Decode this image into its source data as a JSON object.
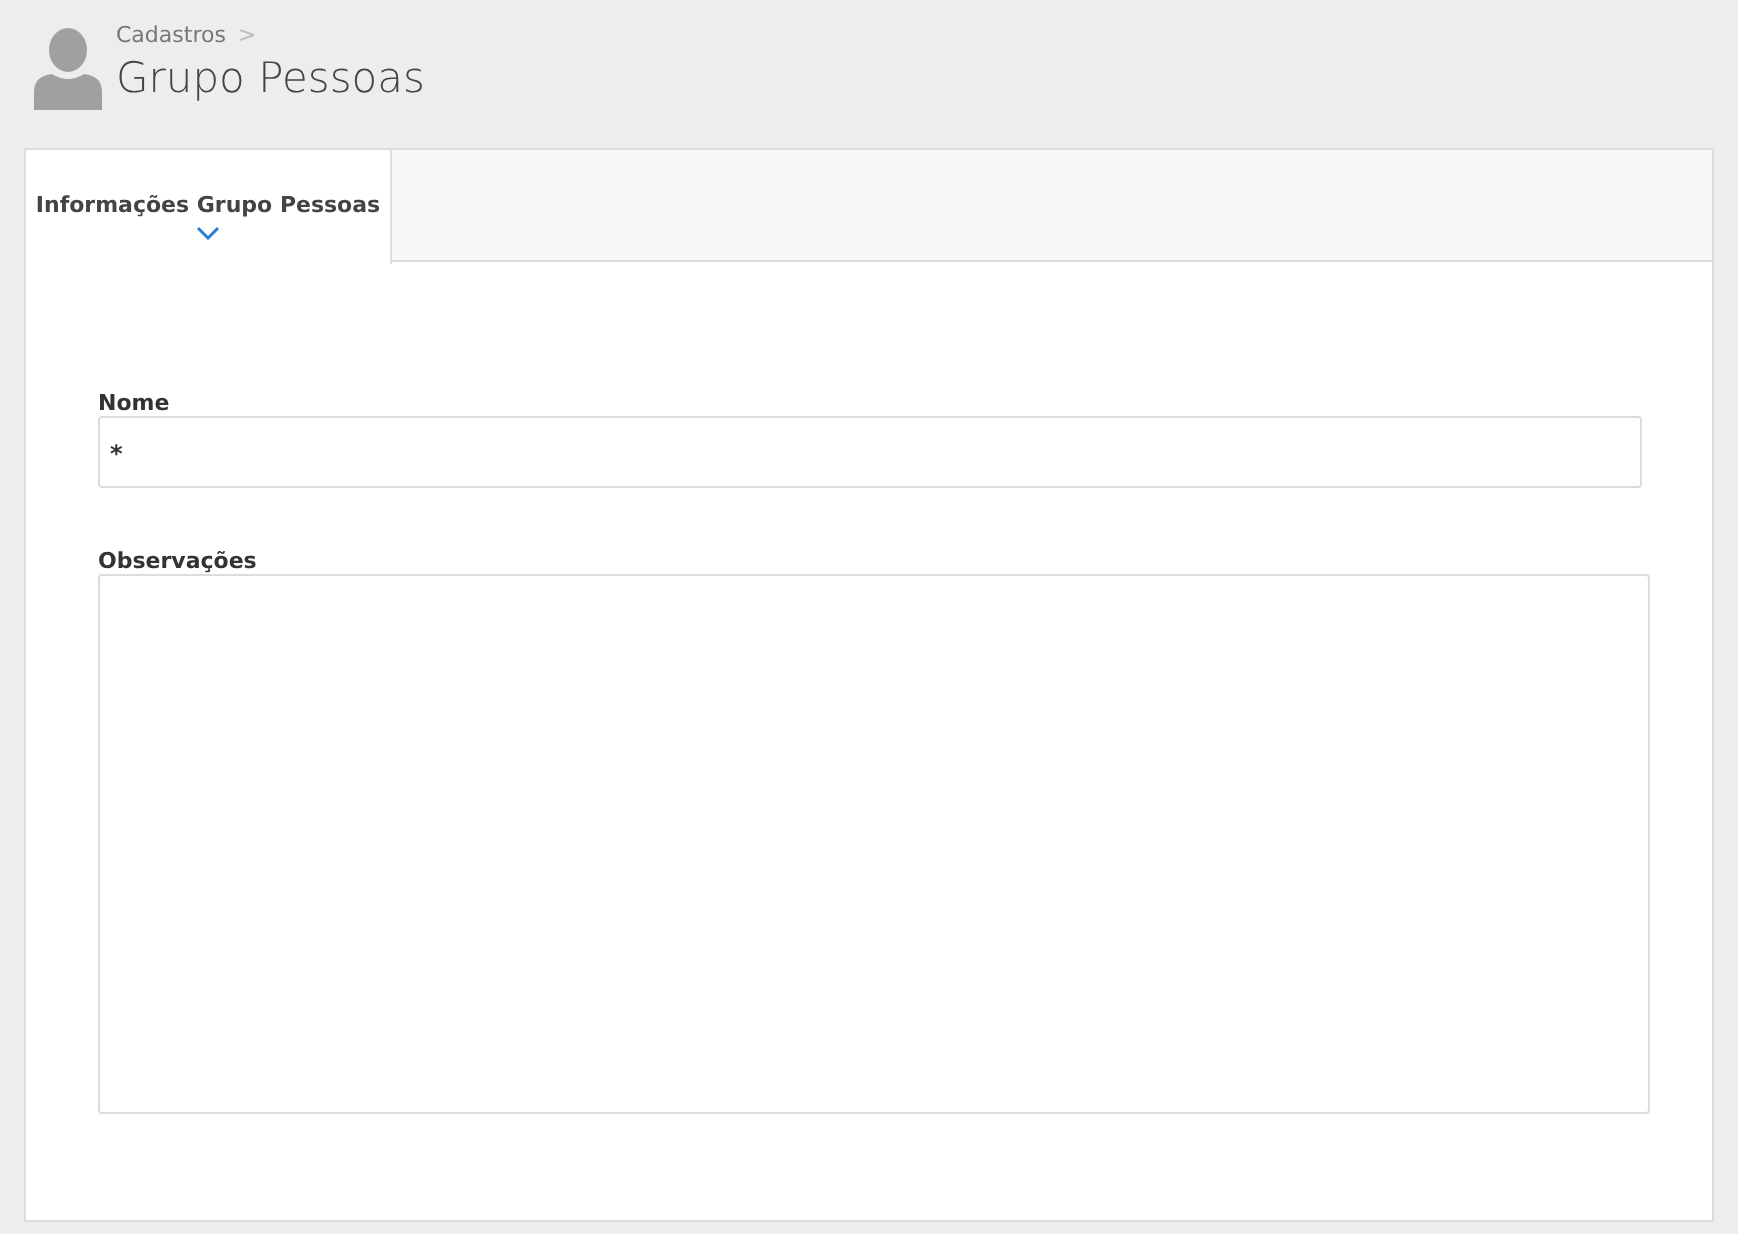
{
  "breadcrumb": {
    "items": [
      "Cadastros"
    ],
    "separator": ">"
  },
  "page_title": "Grupo Pessoas",
  "tabs": [
    {
      "label": "Informações Grupo Pessoas",
      "selected": true
    }
  ],
  "fields": [
    {
      "kind": "input",
      "label": "Nome",
      "required_mark": "*"
    },
    {
      "kind": "textarea",
      "label": "Observações"
    }
  ]
}
